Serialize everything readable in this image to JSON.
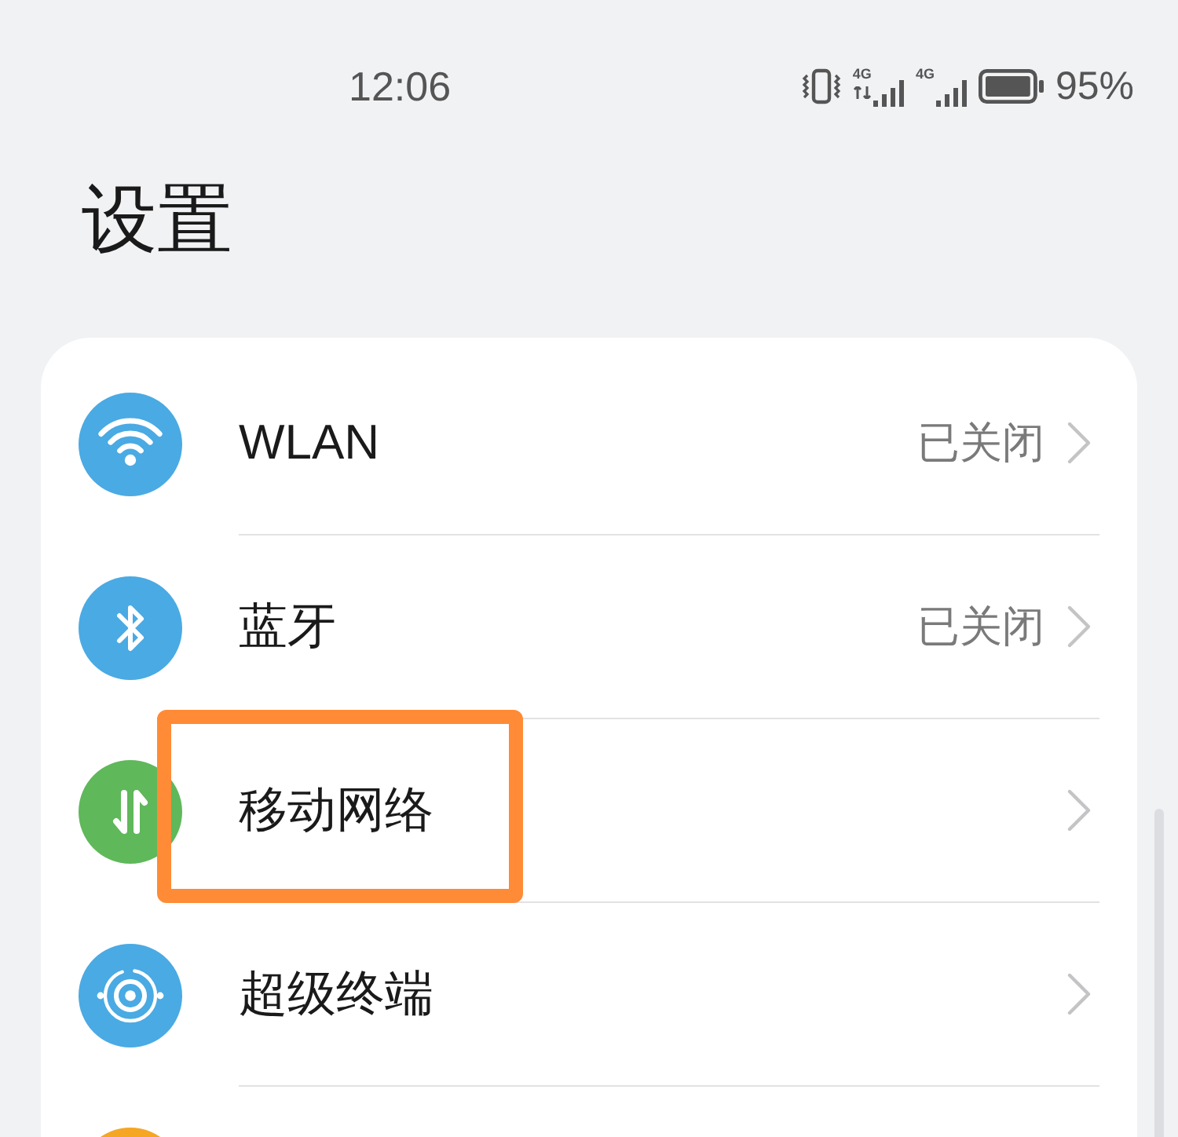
{
  "status_bar": {
    "time": "12:06",
    "signals": [
      {
        "network": "4G",
        "data_activity": true
      },
      {
        "network": "4G",
        "data_activity": false
      }
    ],
    "battery_reading": "95%"
  },
  "title": "设置",
  "settings": [
    {
      "kind": "wifi",
      "label": "WLAN",
      "value": "已关闭",
      "color": "#4aaae3",
      "highlighted": false
    },
    {
      "kind": "bluetooth",
      "label": "蓝牙",
      "value": "已关闭",
      "color": "#4aaae3",
      "highlighted": false
    },
    {
      "kind": "data",
      "label": "移动网络",
      "color": "#5fb85a",
      "highlighted": true
    },
    {
      "kind": "devices",
      "label": "超级终端",
      "color": "#4aaae3",
      "highlighted": false
    },
    {
      "kind": "cutoff",
      "color": "#f5a623",
      "highlighted": false
    }
  ]
}
